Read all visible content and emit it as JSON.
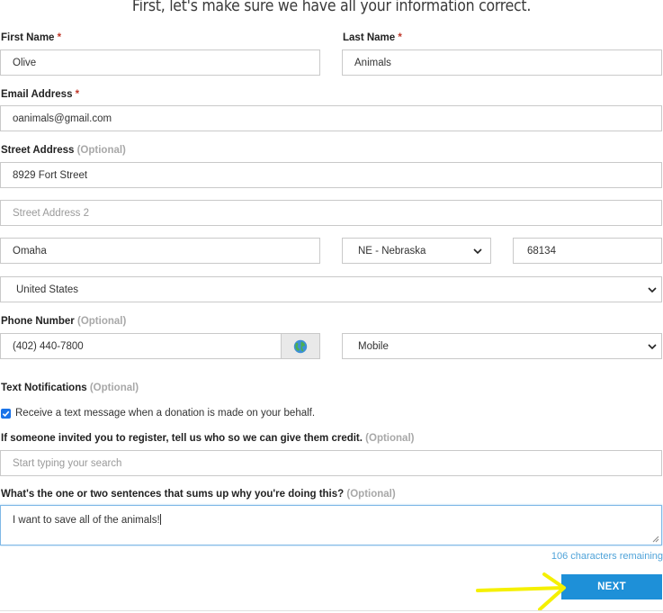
{
  "heading": "First, let's make sure we have all your information correct.",
  "first_name": {
    "label": "First Name",
    "required": "*",
    "value": "Olive"
  },
  "last_name": {
    "label": "Last Name",
    "required": "*",
    "value": "Animals"
  },
  "email": {
    "label": "Email Address",
    "required": "*",
    "value": "oanimals@gmail.com"
  },
  "street": {
    "label": "Street Address",
    "optional": "(Optional)",
    "line1": "8929 Fort Street",
    "line2_placeholder": "Street Address 2",
    "city": "Omaha",
    "state": "NE - Nebraska",
    "zip": "68134",
    "country": "United States"
  },
  "phone": {
    "label": "Phone Number",
    "optional": "(Optional)",
    "value": "(402) 440-7800",
    "type": "Mobile",
    "globe_icon": "globe-icon"
  },
  "text_notifications": {
    "label": "Text Notifications",
    "optional": "(Optional)",
    "checkbox_label": "Receive a text message when a donation is made on your behalf.",
    "checked": true
  },
  "referral": {
    "label": "If someone invited you to register, tell us who so we can give them credit.",
    "optional": "(Optional)",
    "placeholder": "Start typing your search"
  },
  "why": {
    "label": "What's the one or two sentences that sums up why you're doing this?",
    "optional": "(Optional)",
    "value": "I want to save all of the animals!",
    "remaining": "106 characters remaining"
  },
  "next_button": {
    "label": "NEXT"
  },
  "colors": {
    "accent": "#1e90d8",
    "required": "#c0392b",
    "annotation_arrow": "#f5f000"
  }
}
